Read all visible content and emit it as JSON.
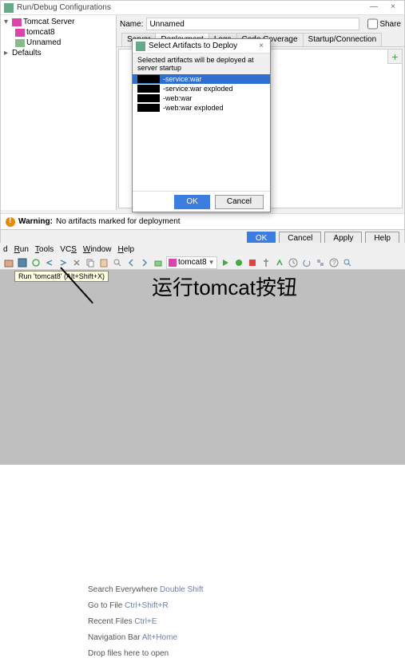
{
  "top": {
    "window_title": "Run/Debug Configurations",
    "tree": {
      "root": "Tomcat Server",
      "children": [
        "tomcat8",
        "Unnamed"
      ],
      "defaults": "Defaults"
    },
    "name_label": "Name:",
    "name_value": "Unnamed",
    "share_label": "Share",
    "tabs": [
      "Server",
      "Deployment",
      "Logs",
      "Code Coverage",
      "Startup/Connection"
    ],
    "active_tab": 1,
    "warning_label": "Warning:",
    "warning_text": "No artifacts marked for deployment",
    "buttons": {
      "ok": "OK",
      "cancel": "Cancel",
      "apply": "Apply",
      "help": "Help"
    }
  },
  "modal": {
    "title": "Select Artifacts to Deploy",
    "subtitle": "Selected artifacts will be deployed at server startup",
    "items": [
      {
        "suffix": "-service:war",
        "selected": true
      },
      {
        "suffix": "-service:war exploded",
        "selected": false
      },
      {
        "suffix": "-web:war",
        "selected": false
      },
      {
        "suffix": "-web:war exploded",
        "selected": false
      }
    ],
    "ok": "OK",
    "cancel": "Cancel"
  },
  "lower": {
    "menus": [
      {
        "text": "d"
      },
      {
        "u": "R",
        "rest": "un"
      },
      {
        "u": "T",
        "rest": "ools"
      },
      {
        "text": "VCS",
        "underline_char": "S"
      },
      {
        "u": "W",
        "rest": "indow"
      },
      {
        "u": "H",
        "rest": "elp"
      }
    ],
    "run_config": "tomcat8",
    "tooltip": "Run 'tomcat8' (Alt+Shift+X)",
    "big_label": "运行tomcat按钮",
    "shortcuts": [
      {
        "label": "Search Everywhere",
        "key": "Double Shift"
      },
      {
        "label": "Go to File",
        "key": "Ctrl+Shift+R"
      },
      {
        "label": "Recent Files",
        "key": "Ctrl+E"
      },
      {
        "label": "Navigation Bar",
        "key": "Alt+Home"
      },
      {
        "label": "Drop files here to open",
        "key": ""
      }
    ]
  }
}
